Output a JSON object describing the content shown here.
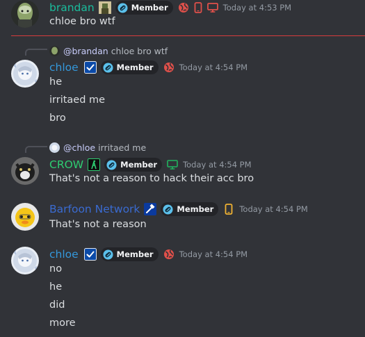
{
  "colors": {
    "background": "#313338",
    "brandan_name": "#1abc9c",
    "chloe_name": "#3498db",
    "crow_name": "#2ecc71",
    "barfoon_name": "#3a6bd1",
    "badge_bg": "#232428",
    "timestamp": "#949ba4",
    "new_divider": "#d83c3e"
  },
  "messages": [
    {
      "author": "brandan",
      "badge": "Member",
      "timestamp": "Today at 4:53 PM",
      "platforms": [
        "globe-icon",
        "mobile-icon",
        "desktop-icon"
      ],
      "lines": [
        "chloe bro wtf"
      ]
    },
    {
      "reply": {
        "mention": "@brandan",
        "text": "chloe bro wtf"
      },
      "author": "chloe",
      "badge": "Member",
      "timestamp": "Today at 4:54 PM",
      "platforms": [
        "globe-icon"
      ],
      "lines": [
        "he",
        "irritaed me",
        "bro"
      ]
    },
    {
      "reply": {
        "mention": "@chloe",
        "text": "irritaed me"
      },
      "author": "CROW",
      "badge": "Member",
      "timestamp": "Today at 4:54 PM",
      "platforms": [
        "desktop-icon"
      ],
      "lines": [
        "That's not a reason to hack their acc bro"
      ]
    },
    {
      "author": "Barfoon Network",
      "badge": "Member",
      "timestamp": "Today at 4:54 PM",
      "platforms": [
        "mobile-icon"
      ],
      "lines": [
        "That's not a reason"
      ]
    },
    {
      "author": "chloe",
      "badge": "Member",
      "timestamp": "Today at 4:54 PM",
      "platforms": [
        "globe-icon"
      ],
      "lines": [
        "no",
        "he",
        "did",
        "more"
      ]
    }
  ]
}
